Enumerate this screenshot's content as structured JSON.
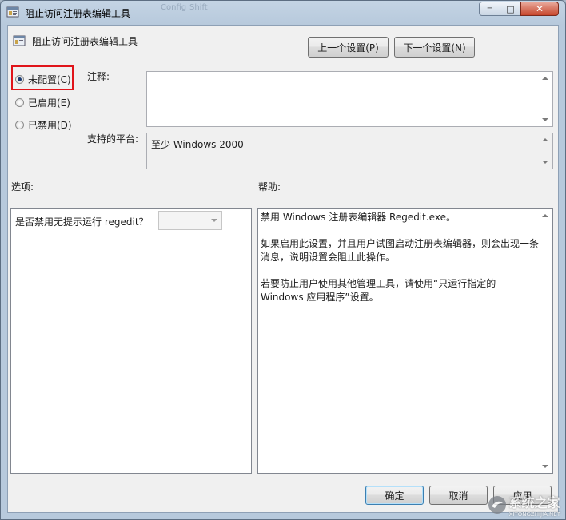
{
  "window": {
    "title": "阻止访问注册表编辑工具",
    "background_tabs": [
      "Config",
      "Shift"
    ],
    "controls": {
      "minimize": "─",
      "maximize": "□",
      "close": "✕"
    }
  },
  "header": {
    "policy_title": "阻止访问注册表编辑工具"
  },
  "nav": {
    "prev_label": "上一个设置(P)",
    "next_label": "下一个设置(N)"
  },
  "state_options": [
    {
      "label": "未配置(C)",
      "selected": true
    },
    {
      "label": "已启用(E)",
      "selected": false
    },
    {
      "label": "已禁用(D)",
      "selected": false
    }
  ],
  "comment": {
    "label": "注释:",
    "value": ""
  },
  "platform": {
    "label": "支持的平台:",
    "value": "至少 Windows 2000"
  },
  "options": {
    "label": "选项:",
    "question": "是否禁用无提示运行 regedit？",
    "dropdown_value": ""
  },
  "help": {
    "label": "帮助:",
    "paragraphs": [
      "禁用 Windows 注册表编辑器 Regedit.exe。",
      "如果启用此设置，并且用户试图启动注册表编辑器，则会出现一条消息，说明设置会阻止此操作。",
      "若要防止用户使用其他管理工具，请使用“只运行指定的 Windows 应用程序”设置。"
    ]
  },
  "footer": {
    "ok_label": "确定",
    "cancel_label": "取消",
    "apply_label": "应用"
  },
  "watermark": {
    "text": "系统之家",
    "subtext": "XITONGZHIJIA.NET"
  },
  "colors": {
    "highlight_box": "#e0141a",
    "radio_dot": "#1c3b70",
    "default_button_border": "#3c7fb1"
  }
}
